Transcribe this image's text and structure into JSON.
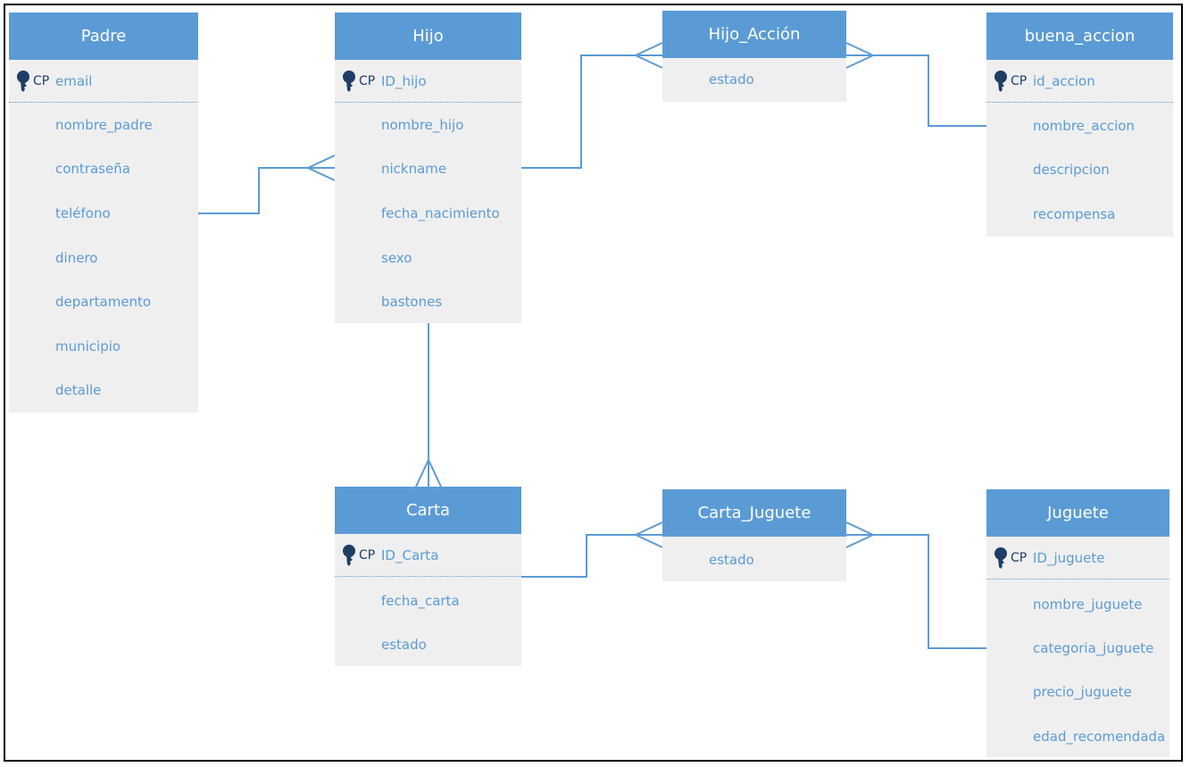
{
  "colors": {
    "header": "#5b9bd5",
    "body": "#efefef",
    "text": "#5b9bd5",
    "key": "#1f3e66",
    "line": "#5b9bd5"
  },
  "pk_label": "CP",
  "entities": {
    "padre": {
      "title": "Padre",
      "pk": "email",
      "fields": [
        "nombre_padre",
        "contraseña",
        "teléfono",
        "dinero",
        "departamento",
        "municipio",
        "detalle"
      ]
    },
    "hijo": {
      "title": "Hijo",
      "pk": "ID_hijo",
      "fields": [
        "nombre_hijo",
        "nickname",
        "fecha_nacimiento",
        "sexo",
        "bastones"
      ]
    },
    "hijo_accion": {
      "title": "Hijo_Acción",
      "fields": [
        "estado"
      ]
    },
    "buena_accion": {
      "title": "buena_accion",
      "pk": "id_accion",
      "fields": [
        "nombre_accion",
        "descripcion",
        "recompensa"
      ]
    },
    "carta": {
      "title": "Carta",
      "pk": "ID_Carta",
      "fields": [
        "fecha_carta",
        "estado"
      ]
    },
    "carta_juguete": {
      "title": "Carta_Juguete",
      "fields": [
        "estado"
      ]
    },
    "juguete": {
      "title": "Juguete",
      "pk": "ID_juguete",
      "fields": [
        "nombre_juguete",
        "categoria_juguete",
        "precio_juguete",
        "edad_recomendada"
      ]
    }
  }
}
